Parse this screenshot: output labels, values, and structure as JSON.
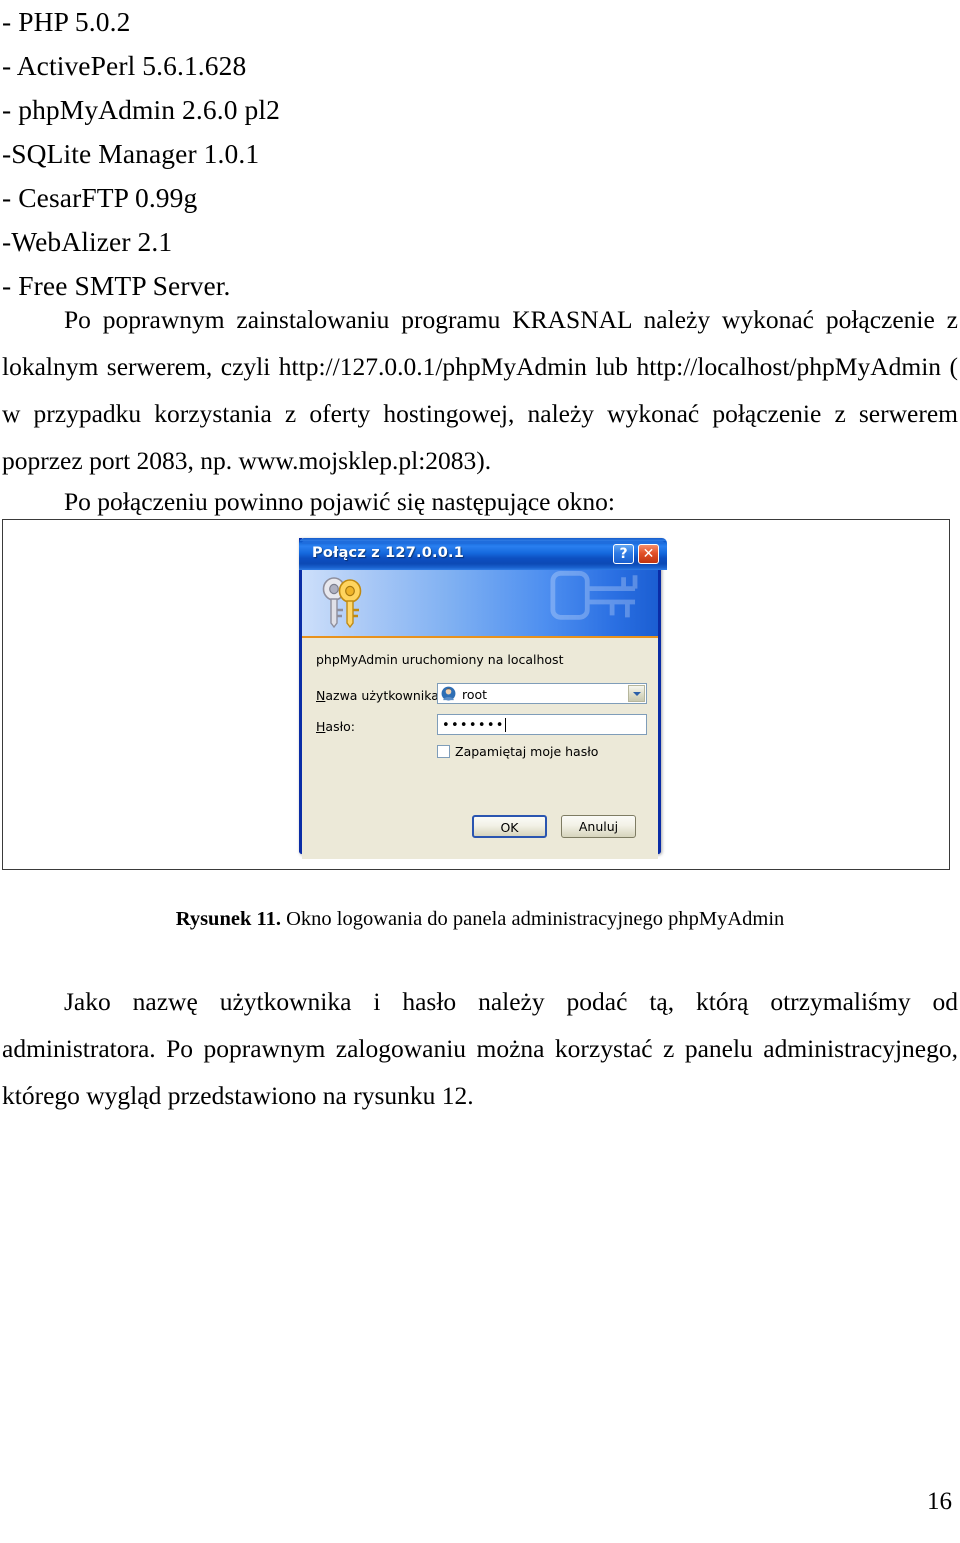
{
  "document": {
    "software_list": [
      "- PHP 5.0.2",
      "- ActivePerl 5.6.1.628",
      "- phpMyAdmin 2.6.0 pl2",
      "-SQLite Manager 1.0.1",
      "- CesarFTP 0.99g",
      "-WebAlizer 2.1",
      "- Free SMTP Server."
    ],
    "paragraph_install": "Po poprawnym zainstalowaniu programu KRASNAL należy wykonać połączenie z lokalnym serwerem, czyli http://127.0.0.1/phpMyAdmin lub http://localhost/phpMyAdmin ( w przypadku korzystania z oferty hostingowej, należy wykonać połączenie z serwerem poprzez port 2083, np. www.mojsklep.pl:2083).",
    "paragraph_connect": "Po połączeniu powinno pojawić się następujące okno:",
    "paragraph_final": "Jako nazwę użytkownika i hasło należy podać tą, którą otrzymaliśmy od administratora. Po poprawnym zalogowaniu można korzystać z panelu administracyjnego, którego wygląd przedstawiono na rysunku 12.",
    "page_number": "16"
  },
  "figure": {
    "caption_label": "Rysunek 11.",
    "caption_text": " Okno logowania do panela administracyjnego phpMyAdmin"
  },
  "dialog": {
    "title": "Połącz z 127.0.0.1",
    "help_button": "?",
    "close_button": "✕",
    "info_text": "phpMyAdmin uruchomiony na localhost",
    "username_label_prefix": "N",
    "username_label_rest": "azwa użytkownika:",
    "username_value": "root",
    "password_label_prefix": "H",
    "password_label_rest": "asło:",
    "password_masked": "•••••••",
    "remember_label": "Zapamiętaj moje hasło",
    "remember_checked": false,
    "ok_label": "OK",
    "cancel_label": "Anuluj",
    "colors": {
      "titlebar_blue": "#0d4fc0",
      "border_blue": "#0a2ca6",
      "body_beige": "#ece9d8",
      "banner_accent_orange": "#e8921d",
      "close_red": "#e2512a"
    }
  }
}
